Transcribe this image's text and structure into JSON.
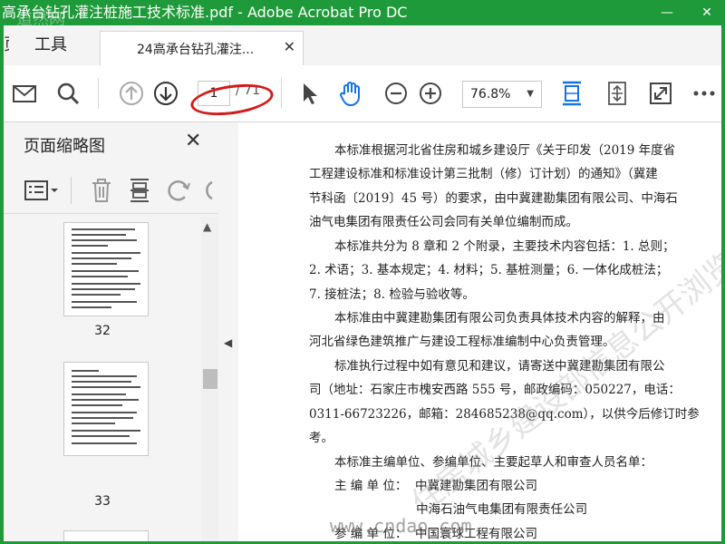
{
  "window": {
    "title": "高承台钻孔灌注桩施工技术标准.pdf - Adobe Acrobat Pro DC",
    "minimize": "—",
    "close": "✕"
  },
  "tabs": {
    "home_fragment": "页",
    "tools": "工具",
    "document": "24高承台钻孔灌注...",
    "document_close": "✕"
  },
  "toolbar": {
    "current_page": "1",
    "total_pages": "/ 71",
    "zoom": "76.8%"
  },
  "side_panel": {
    "title": "页面缩略图",
    "close": "✕",
    "thumbnails": [
      {
        "label": "32"
      },
      {
        "label": "33"
      }
    ]
  },
  "document": {
    "paragraphs": [
      [
        "本标准根据河北省住房和城乡建设厅《关于印发（2019 年度省",
        "工程建设标准和标准设计第三批制（修）订计划）的通知》（冀建",
        "节科函〔2019〕45 号）的要求，由中冀建勘集团有限公司、中海石",
        "油气电集团有限责任公司会同有关单位编制而成。"
      ],
      [
        "本标准共分为 8 章和 2 个附录，主要技术内容包括：1. 总则；",
        "2. 术语；3. 基本规定；4. 材料；5. 基桩测量；6. 一体化成桩法；",
        "7. 接桩法；8. 检验与验收等。"
      ],
      [
        "本标准由中冀建勘集团有限公司负责具体技术内容的解释，由",
        "河北省绿色建筑推广与建设工程标准编制中心负责管理。"
      ],
      [
        "标准执行过程中如有意见和建议，请寄送中冀建勘集团有限公",
        "司（地址：石家庄市槐安西路 555 号，邮政编码：050227，电话：",
        "0311-66723226，邮箱：284685238@qq.com），以供今后修订时参",
        "考。"
      ],
      [
        "本标准主编单位、参编单位、主要起草人和审查人员名单："
      ],
      [
        "主 编 单 位：  中冀建勘集团有限公司",
        "                     中海石油气电集团有限责任公司",
        "参 编 单 位：  中国寰球工程有限公司"
      ]
    ]
  },
  "watermarks": {
    "diagonal": "住房城乡建设部信息公开浏览专用",
    "site": "www.cndao.com",
    "logo": "道然网"
  },
  "colors": {
    "title_bar": "#1f9a3a",
    "accent_blue": "#1473e6",
    "annotation_red": "#d21b1b"
  }
}
